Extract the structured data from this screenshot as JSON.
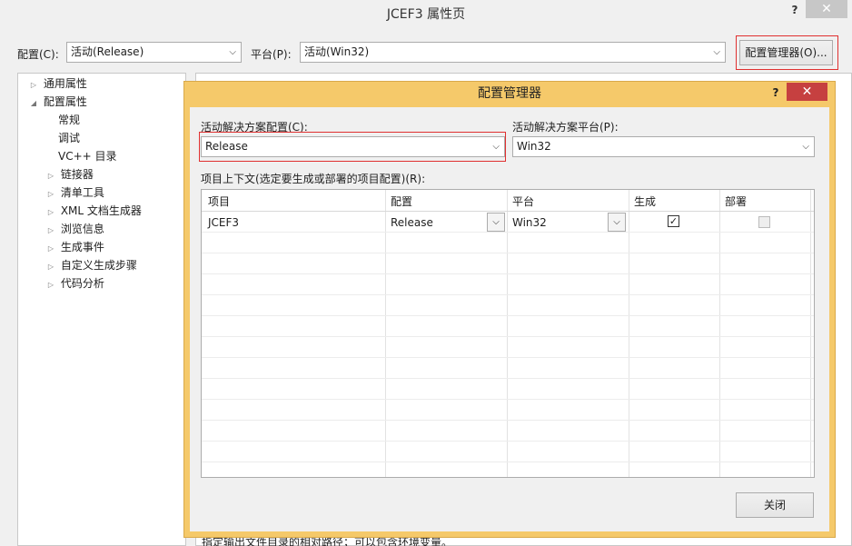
{
  "window": {
    "title": "JCEF3 属性页",
    "help": "?",
    "close": "✕"
  },
  "toolbar": {
    "config_label": "配置(C):",
    "config_value": "活动(Release)",
    "platform_label": "平台(P):",
    "platform_value": "活动(Win32)",
    "config_manager_button": "配置管理器(O)..."
  },
  "tree": {
    "items": [
      {
        "label": "通用属性",
        "twisty": "▷"
      },
      {
        "label": "配置属性",
        "twisty": "◢"
      },
      {
        "label": "常规",
        "twisty": ""
      },
      {
        "label": "调试",
        "twisty": ""
      },
      {
        "label": "VC++ 目录",
        "twisty": ""
      },
      {
        "label": "链接器",
        "twisty": "▷"
      },
      {
        "label": "清单工具",
        "twisty": "▷"
      },
      {
        "label": "XML 文档生成器",
        "twisty": "▷"
      },
      {
        "label": "浏览信息",
        "twisty": "▷"
      },
      {
        "label": "生成事件",
        "twisty": "▷"
      },
      {
        "label": "自定义生成步骤",
        "twisty": "▷"
      },
      {
        "label": "代码分析",
        "twisty": "▷"
      }
    ]
  },
  "right_panel": {
    "bottom_text": "指定输出文件目录的相对路径；可以包含环境变量。"
  },
  "dialog": {
    "title": "配置管理器",
    "help": "?",
    "close": "✕",
    "active_config_label": "活动解决方案配置(C):",
    "active_config_value": "Release",
    "active_platform_label": "活动解决方案平台(P):",
    "active_platform_value": "Win32",
    "contexts_label": "项目上下文(选定要生成或部署的项目配置)(R):",
    "columns": [
      "项目",
      "配置",
      "平台",
      "生成",
      "部署"
    ],
    "rows": [
      {
        "project": "JCEF3",
        "config": "Release",
        "platform": "Win32",
        "build": true,
        "deploy": false
      }
    ],
    "close_button": "关闭"
  }
}
